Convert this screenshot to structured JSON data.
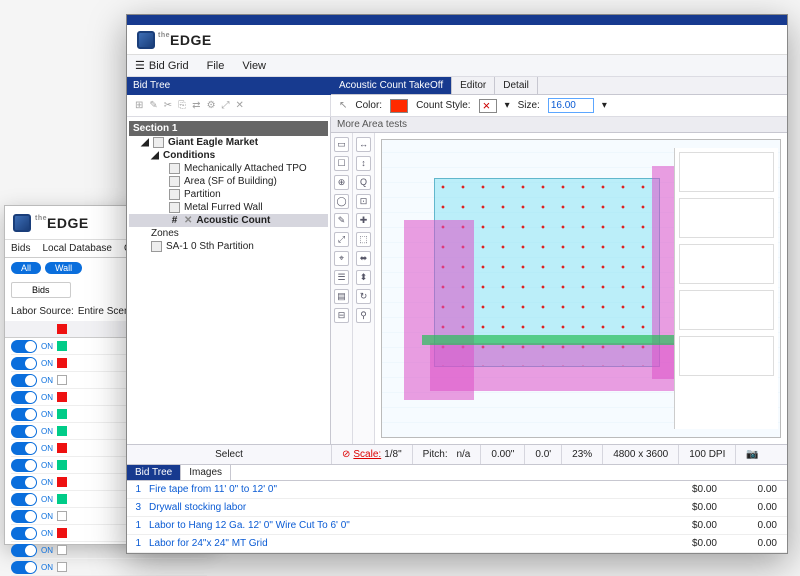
{
  "app": {
    "brand_prefix": "the",
    "brand": "EDGE"
  },
  "back": {
    "tabs": [
      "Bids",
      "Local Database",
      "Optio"
    ],
    "pill_all": "All",
    "pill_wall": "Wall",
    "pill_bids": "Bids",
    "labor_src_label": "Labor Source:",
    "labor_src_value": "Entire Scen",
    "on_label": "ON"
  },
  "menu": {
    "bid_grid": "Bid Grid",
    "file": "File",
    "view": "View"
  },
  "bidtree": {
    "title": "Bid Tree",
    "section": "Section 1",
    "root": "Giant Eagle Market",
    "conditions": "Conditions",
    "c1": "Mechanically Attached TPO",
    "c2": "Area (SF of Building)",
    "c3": "Partition",
    "c4": "Metal Furred Wall",
    "c5": "Acoustic Count",
    "zones": "Zones",
    "zone1": "SA-1 0 Sth Partition",
    "tab_bidtree": "Bid Tree",
    "tab_images": "Images"
  },
  "take": {
    "tab1": "Acoustic Count TakeOff",
    "tab2": "Editor",
    "tab3": "Detail",
    "color_label": "Color:",
    "count_style_label": "Count Style:",
    "size_label": "Size:",
    "size_value": "16.00",
    "sub_header": "More Area tests"
  },
  "status": {
    "select": "Select",
    "scale_label": "Scale:",
    "scale_value": "1/8\"",
    "pitch_label": "Pitch:",
    "pitch_value": "n/a",
    "zero_a": "0.00\"",
    "zero_b": "0.0'",
    "pct": "23%",
    "dims": "4800 x 3600",
    "dpi": "100 DPI"
  },
  "items": [
    {
      "qty": "1",
      "desc": "Fire tape from 11' 0\" to 12' 0\"",
      "a": "$0.00",
      "b": "0.00"
    },
    {
      "qty": "3",
      "desc": "Drywall stocking labor",
      "a": "$0.00",
      "b": "0.00"
    },
    {
      "qty": "1",
      "desc": "Labor to Hang 12 Ga. 12' 0\" Wire Cut To 6' 0\"",
      "a": "$0.00",
      "b": "0.00"
    },
    {
      "qty": "1",
      "desc": "Labor for 24\"x 24\" MT Grid",
      "a": "$0.00",
      "b": "0.00"
    }
  ]
}
